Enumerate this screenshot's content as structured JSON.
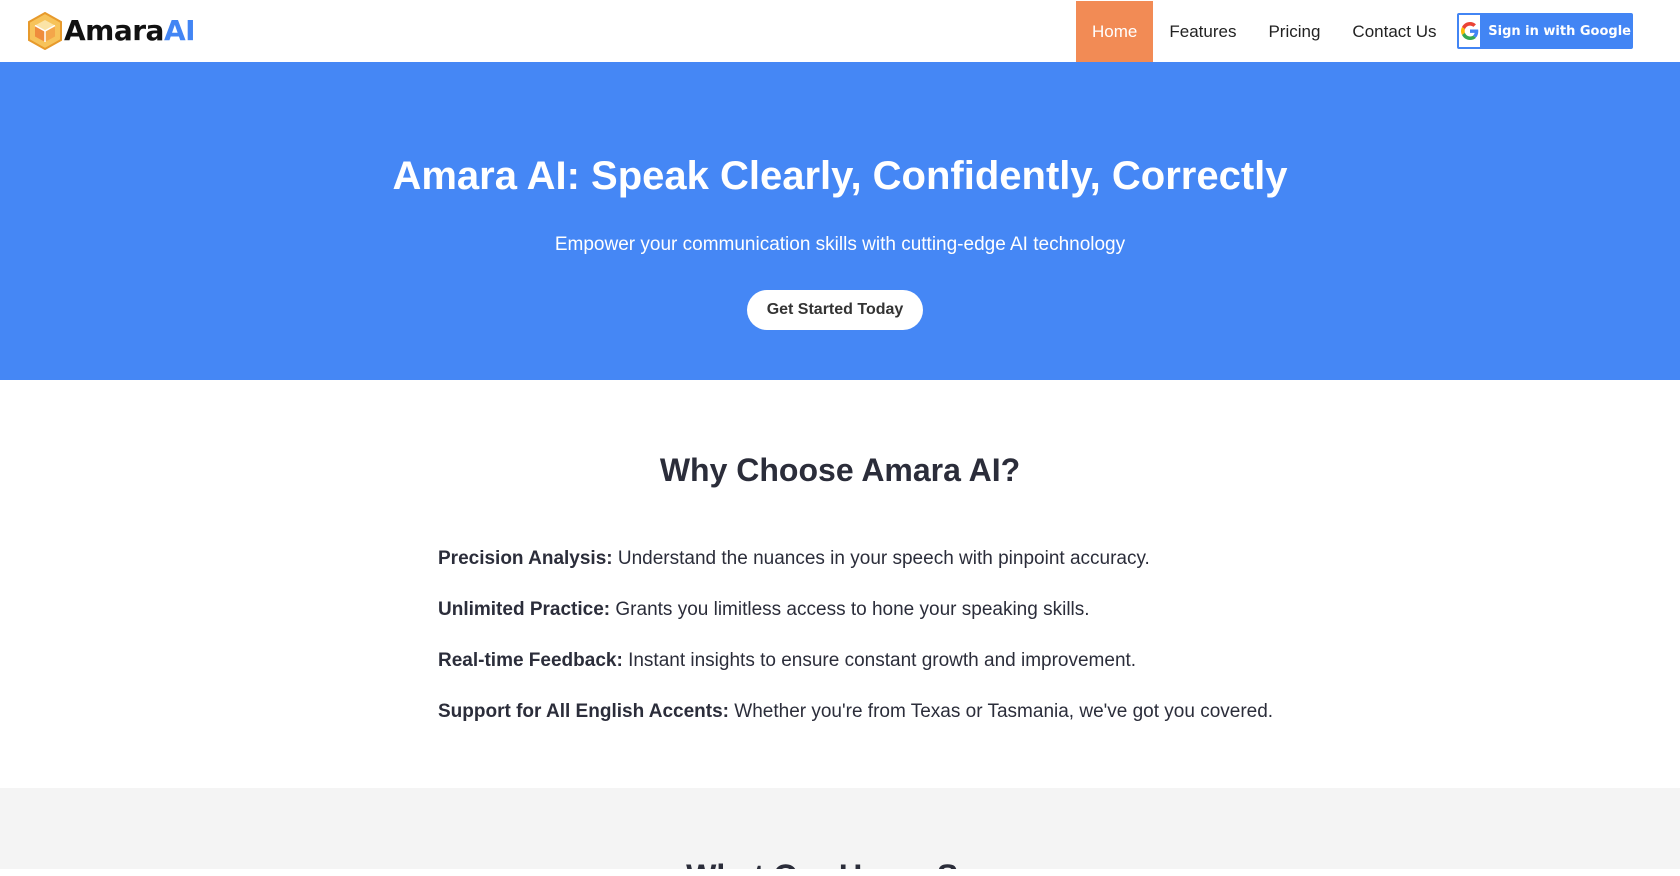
{
  "brand": {
    "name_part1": "Amara",
    "name_part2": "AI",
    "logo_icon": "hexagon-cube-logo-icon",
    "accent_color": "#4285f4",
    "logo_color": "#f2b33d"
  },
  "nav": {
    "items": [
      {
        "label": "Home",
        "active": true
      },
      {
        "label": "Features",
        "active": false
      },
      {
        "label": "Pricing",
        "active": false
      },
      {
        "label": "Contact Us",
        "active": false
      }
    ],
    "active_color": "#f28b55"
  },
  "google_signin": {
    "label": "Sign in with Google",
    "icon": "google-g-icon"
  },
  "hero": {
    "title": "Amara AI: Speak Clearly, Confidently, Correctly",
    "subtitle": "Empower your communication skills with cutting-edge AI technology",
    "cta_label": "Get Started Today",
    "background_color": "#4587f5"
  },
  "features": {
    "heading": "Why Choose Amara AI?",
    "items": [
      {
        "title": "Precision Analysis:",
        "text": "Understand the nuances in your speech with pinpoint accuracy."
      },
      {
        "title": "Unlimited Practice:",
        "text": "Grants you limitless access to hone your speaking skills."
      },
      {
        "title": "Real-time Feedback:",
        "text": "Instant insights to ensure constant growth and improvement."
      },
      {
        "title": "Support for All English Accents:",
        "text": "Whether you're from Texas or Tasmania, we've got you covered."
      }
    ]
  },
  "next_section": {
    "heading": "What Our Users Say"
  }
}
